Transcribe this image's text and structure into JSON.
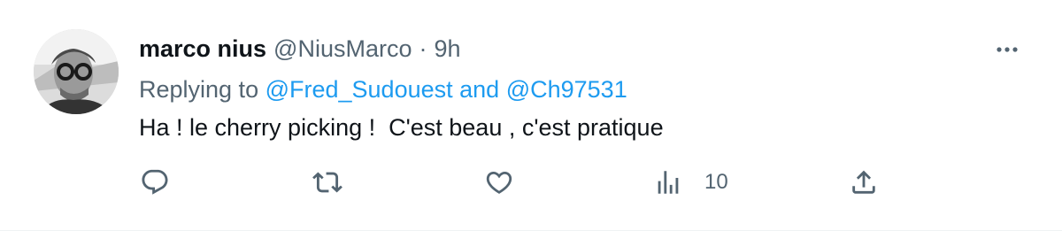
{
  "tweet": {
    "author": {
      "display_name": "marco nius",
      "handle": "@NiusMarco",
      "separator": "·",
      "time": "9h"
    },
    "replying": {
      "prefix": "Replying to ",
      "user1": "@Fred_Sudouest",
      "conjunction": " and ",
      "user2": "@Ch97531"
    },
    "text": "Ha ! le cherry picking !  C'est beau , c'est pratique",
    "actions": {
      "views_count": "10"
    },
    "icons": {
      "more": "more-horizontal-icon",
      "reply": "reply-icon",
      "retweet": "retweet-icon",
      "like": "like-icon",
      "views": "views-icon",
      "share": "share-icon"
    },
    "colors": {
      "link": "#1d9bf0",
      "secondary_text": "#536471",
      "primary_text": "#0f1419"
    }
  }
}
